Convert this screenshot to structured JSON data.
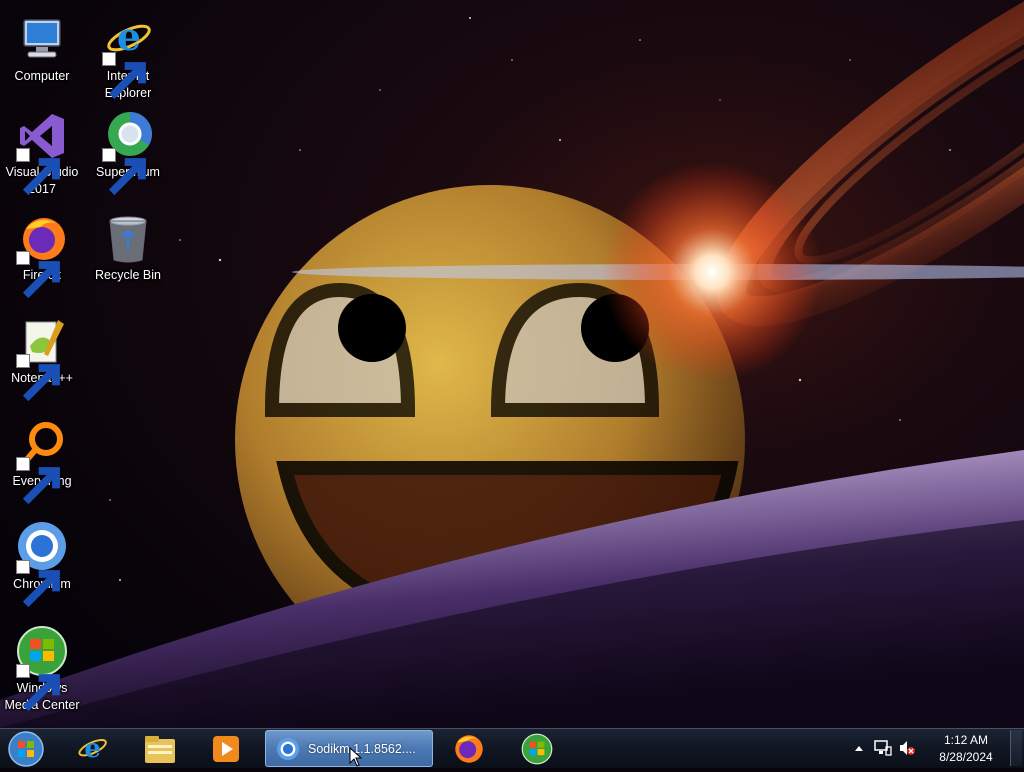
{
  "desktop": {
    "icons": [
      {
        "label": "Computer",
        "icon": "computer-icon"
      },
      {
        "label": "Internet\nExplorer",
        "icon": "internet-explorer-icon"
      },
      {
        "label": "Visual Studio\n2017",
        "icon": "visual-studio-icon"
      },
      {
        "label": "Supermium",
        "icon": "supermium-icon"
      },
      {
        "label": "Firefox",
        "icon": "firefox-icon"
      },
      {
        "label": "Recycle Bin",
        "icon": "recycle-bin-icon"
      },
      {
        "label": "Notepad++",
        "icon": "notepad-plus-plus-icon"
      },
      {
        "label": "Everything",
        "icon": "everything-icon"
      },
      {
        "label": "Chromium",
        "icon": "chromium-icon"
      },
      {
        "label": "Windows\nMedia Center",
        "icon": "windows-media-center-icon"
      }
    ]
  },
  "taskbar": {
    "start_icon": "windows-start-orb-icon",
    "pinned": [
      "internet-explorer-icon",
      "file-explorer-icon",
      "media-player-icon",
      "firefox-icon",
      "windows-media-center-icon"
    ],
    "active_task": {
      "label": "Sodikm 1.1.8562....",
      "icon": "chromium-icon"
    },
    "tray": {
      "icons": [
        "show-hidden-icons-chevron",
        "network-icon",
        "volume-muted-icon"
      ],
      "time": "1:12 AM",
      "date": "8/28/2024"
    }
  },
  "colors": {
    "taskbar": "#101622",
    "active_task": "#4d7bb5",
    "text": "#ffffff"
  }
}
